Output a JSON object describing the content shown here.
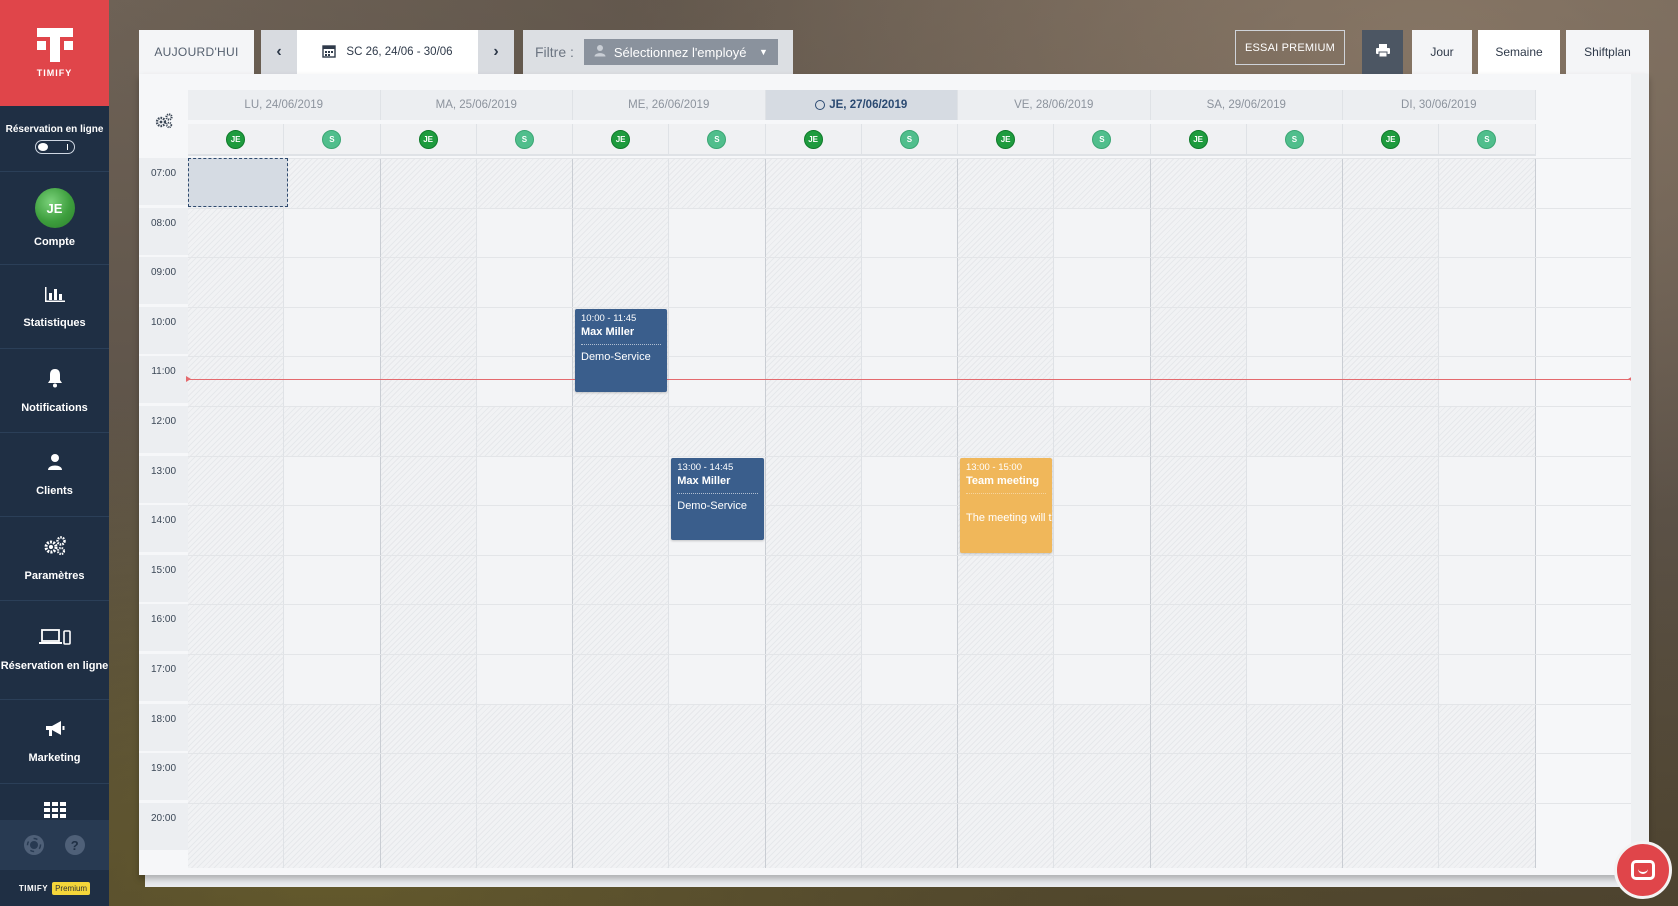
{
  "app": {
    "name": "TIMIFY"
  },
  "sidebar": {
    "online_booking_toggle_label": "Réservation en ligne",
    "items": [
      {
        "label": "Compte",
        "icon": "avatar",
        "avatar_initials": "JE"
      },
      {
        "label": "Statistiques",
        "icon": "bar-chart-icon"
      },
      {
        "label": "Notifications",
        "icon": "bell-icon"
      },
      {
        "label": "Clients",
        "icon": "user-icon"
      },
      {
        "label": "Paramètres",
        "icon": "gears-icon"
      },
      {
        "label": "Réservation en ligne",
        "icon": "laptop-mobile-icon"
      },
      {
        "label": "Marketing",
        "icon": "megaphone-icon"
      }
    ],
    "brand_label": "TIMIFY",
    "plan_badge": "Premium"
  },
  "toolbar": {
    "today_label": "AUJOURD'HUI",
    "week_label": "SC 26, 24/06 - 30/06",
    "filter_label": "Filtre :",
    "filter_placeholder": "Sélectionnez l'employé",
    "premium_label": "ESSAI PREMIUM",
    "view_day": "Jour",
    "view_week": "Semaine",
    "view_shiftplan": "Shiftplan"
  },
  "calendar": {
    "days": [
      {
        "label": "LU, 24/06/2019"
      },
      {
        "label": "MA, 25/06/2019"
      },
      {
        "label": "ME, 26/06/2019"
      },
      {
        "label": "JE, 27/06/2019",
        "today": true
      },
      {
        "label": "VE, 28/06/2019"
      },
      {
        "label": "SA, 29/06/2019"
      },
      {
        "label": "DI, 30/06/2019"
      }
    ],
    "employees": [
      {
        "initials": "JE",
        "color": "#1e9b3e"
      },
      {
        "initials": "S",
        "color": "#50be8c"
      }
    ],
    "hours": [
      "07:00",
      "08:00",
      "09:00",
      "10:00",
      "11:00",
      "12:00",
      "13:00",
      "14:00",
      "15:00",
      "16:00",
      "17:00",
      "18:00",
      "19:00",
      "20:00"
    ],
    "events": [
      {
        "time": "10:00 - 11:45",
        "title": "Max Miller",
        "service": "Demo-Service",
        "color": "#3a5e8c"
      },
      {
        "time": "13:00 - 14:45",
        "title": "Max Miller",
        "service": "Demo-Service",
        "color": "#3a5e8c"
      },
      {
        "time": "13:00 - 15:00",
        "title": "Team meeting",
        "service": "The meeting will ta",
        "color": "#f0b75a"
      }
    ]
  }
}
